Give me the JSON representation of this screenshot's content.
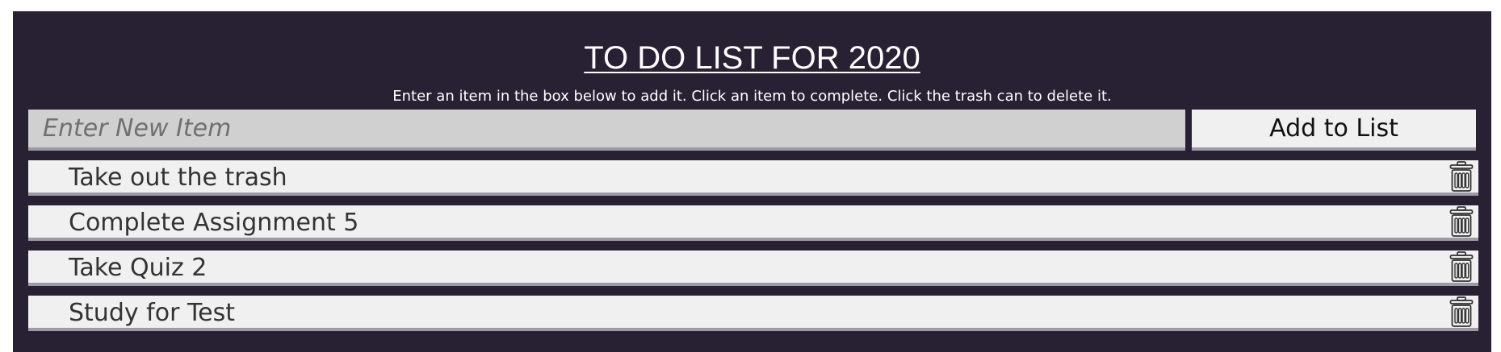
{
  "header": {
    "title": "TO DO LIST FOR 2020",
    "instructions": "Enter an item in the box below to add it. Click an item to complete. Click the trash can to delete it."
  },
  "input": {
    "placeholder": "Enter New Item",
    "value": ""
  },
  "add_button": {
    "label": "Add to List"
  },
  "todo_items": [
    {
      "label": "Take out the trash",
      "delete_icon": "trash-icon"
    },
    {
      "label": "Complete Assignment 5",
      "delete_icon": "trash-icon"
    },
    {
      "label": "Take Quiz 2",
      "delete_icon": "trash-icon"
    },
    {
      "label": "Study for Test",
      "delete_icon": "trash-icon"
    }
  ],
  "colors": {
    "panel_background": "#282133",
    "input_background": "#d0d0d0",
    "item_background": "#f0f0f0",
    "item_border": "#9e9aa4",
    "title_text": "#ffffff"
  }
}
